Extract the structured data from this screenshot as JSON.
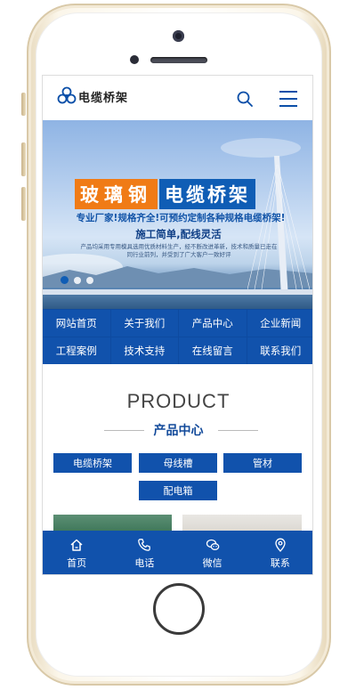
{
  "header": {
    "logo_text": "电缆桥架",
    "icons": [
      "logo-icon",
      "search-icon",
      "menu-icon"
    ]
  },
  "banner": {
    "title_orange": "玻璃钢",
    "title_blue": "电缆桥架",
    "subtitle": "专业厂家!规格齐全!可预约定制各种规格电缆桥架!",
    "slogan": "施工简单,配线灵活",
    "desc_line1": "产品均采用专用模具选用优质材料生产，经不断改进革新，技术和质量已走在",
    "desc_line2": "同行业前列，并受到了广大客户一致好评",
    "slide_count": 3,
    "active_slide": 1
  },
  "nav": {
    "items": [
      {
        "label": "网站首页"
      },
      {
        "label": "关于我们"
      },
      {
        "label": "产品中心"
      },
      {
        "label": "企业新闻"
      },
      {
        "label": "工程案例"
      },
      {
        "label": "技术支持"
      },
      {
        "label": "在线留言"
      },
      {
        "label": "联系我们"
      }
    ]
  },
  "product": {
    "title_en": "PRODUCT",
    "title_cn": "产品中心",
    "categories": [
      {
        "label": "电缆桥架"
      },
      {
        "label": "母线槽"
      },
      {
        "label": "管材"
      },
      {
        "label": "配电箱"
      }
    ]
  },
  "bottom_bar": {
    "tabs": [
      {
        "label": "首页",
        "icon": "home-icon"
      },
      {
        "label": "电话",
        "icon": "phone-icon"
      },
      {
        "label": "微信",
        "icon": "wechat-icon"
      },
      {
        "label": "联系",
        "icon": "location-icon"
      }
    ]
  },
  "colors": {
    "primary_blue": "#1152ac",
    "accent_orange": "#f07b16",
    "banner_title_blue": "#0f5db5"
  }
}
